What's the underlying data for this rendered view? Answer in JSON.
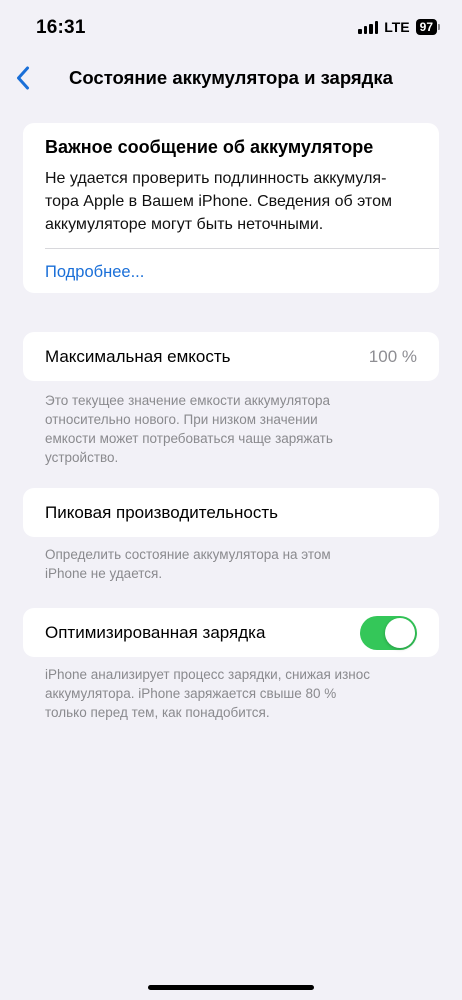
{
  "status_bar": {
    "time": "16:31",
    "network": "LTE",
    "battery": "97",
    "signal_icon": "cellular-signal-icon"
  },
  "nav": {
    "back_icon": "chevron-left-icon",
    "title": "Состояние аккумулятора и зарядка"
  },
  "notice": {
    "title": "Важное сообщение об аккумуляторе",
    "body_lines": [
      "Не удается проверить подлинность аккумуля-",
      "тора Apple в Вашем iPhone. Сведения об этом",
      "аккумуляторе могут быть неточными."
    ],
    "link": "Подробнее..."
  },
  "max_capacity": {
    "label": "Максимальная емкость",
    "value": "100 %",
    "footnote_lines": [
      "Это текущее значение емкости аккумулятора",
      "относительно нового. При низком значении",
      "емкости может потребоваться чаще заряжать",
      "устройство."
    ]
  },
  "peak_performance": {
    "label": "Пиковая производительность",
    "footnote_lines": [
      "Определить состояние аккумулятора на этом",
      "iPhone не удается."
    ]
  },
  "optimized_charging": {
    "label": "Оптимизированная зарядка",
    "enabled": true,
    "footnote_lines": [
      "iPhone анализирует процесс зарядки, снижая износ",
      "аккумулятора. iPhone заряжается свыше 80 %",
      "только перед тем, как понадобится."
    ]
  },
  "colors": {
    "background": "#f2f1f7",
    "accent": "#1a6fd8",
    "toggle_on": "#34c759",
    "secondary_text": "#8a8a8e"
  }
}
